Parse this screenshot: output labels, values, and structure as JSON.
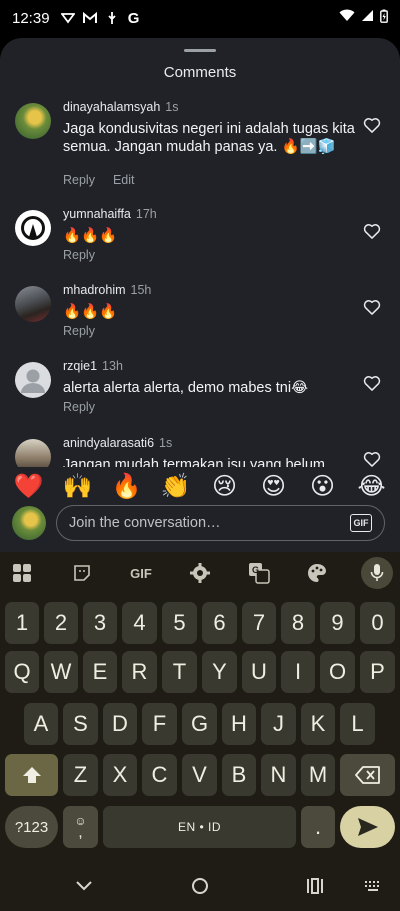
{
  "status_bar": {
    "time": "12:39",
    "left_icons": [
      "signal-app-icon",
      "gmail-icon",
      "usb-icon",
      "google-icon"
    ],
    "right_icons": [
      "wifi-icon",
      "cell-signal-icon",
      "battery-icon"
    ]
  },
  "sheet": {
    "title": "Comments"
  },
  "comments": [
    {
      "username": "dinayahalamsyah",
      "time": "1s",
      "text": "Jaga kondusivitas negeri ini adalah tugas kita semua. Jangan mudah panas ya. 🔥➡️🧊",
      "actions": [
        "Reply",
        "Edit"
      ]
    },
    {
      "username": "yumnahaiffa",
      "time": "17h",
      "text": "🔥🔥🔥",
      "actions": [
        "Reply"
      ]
    },
    {
      "username": "mhadrohim",
      "time": "15h",
      "text": "🔥🔥🔥",
      "actions": [
        "Reply"
      ]
    },
    {
      "username": "rzqie1",
      "time": "13h",
      "text": "alerta alerta alerta, demo mabes tni😂",
      "actions": [
        "Reply"
      ]
    },
    {
      "username": "anindyalarasati6",
      "time": "1s",
      "text": "Jangan mudah termakan isu yang belum",
      "actions": []
    }
  ],
  "reactions": [
    "❤️",
    "🙌",
    "🔥",
    "👏",
    "😢",
    "😍",
    "😮",
    "😂"
  ],
  "composer": {
    "placeholder": "Join the conversation…",
    "gif_label": "GIF"
  },
  "keyboard": {
    "toolbar": {
      "gif_label": "GIF"
    },
    "rows": [
      [
        "1",
        "2",
        "3",
        "4",
        "5",
        "6",
        "7",
        "8",
        "9",
        "0"
      ],
      [
        "Q",
        "W",
        "E",
        "R",
        "T",
        "Y",
        "U",
        "I",
        "O",
        "P"
      ],
      [
        "A",
        "S",
        "D",
        "F",
        "G",
        "H",
        "J",
        "K",
        "L"
      ],
      [
        "Z",
        "X",
        "C",
        "V",
        "B",
        "N",
        "M"
      ]
    ],
    "symbols_label": "?123",
    "emoji_comma_top": "☺",
    "emoji_comma_bottom": ",",
    "space_label": "EN • ID",
    "period_label": "."
  },
  "colors": {
    "sheet_bg": "#202227",
    "keyboard_bg": "#1e1c15",
    "key_bg": "#3a392f",
    "accent_key": "#6b6643",
    "enter_key": "#d7d1a4"
  }
}
